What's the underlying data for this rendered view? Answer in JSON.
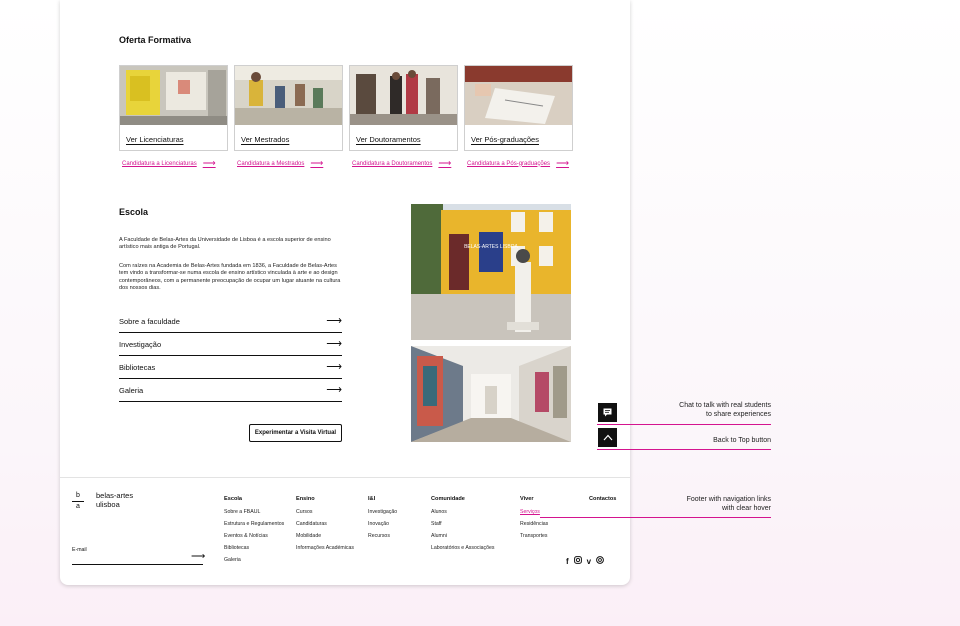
{
  "offer": {
    "title": "Oferta Formativa",
    "cards": [
      {
        "label": "Ver Licenciaturas",
        "apply": "Candidatura a Licenciaturas"
      },
      {
        "label": "Ver Mestrados",
        "apply": "Candidatura a Mestrados"
      },
      {
        "label": "Ver Doutoramentos",
        "apply": "Candidatura a Doutoramentos"
      },
      {
        "label": "Ver Pós-graduações",
        "apply": "Candidatura a Pós-graduações"
      }
    ]
  },
  "school": {
    "title": "Escola",
    "para1": "A Faculdade de Belas-Artes da Universidade de Lisboa é a escola superior de ensino artístico mais antiga de Portugal.",
    "para2": "Com raízes na Academia de Belas-Artes fundada em 1836, a Faculdade de Belas-Artes tem vindo a transformar-se numa escola de ensino artístico vinculada à arte e ao design contemporâneos, com a permanente preocupação de ocupar um lugar atuante na cultura dos nossos dias.",
    "links": [
      "Sobre a faculdade",
      "Investigação",
      "Bibliotecas",
      "Galeria"
    ],
    "virtual_button": "Experimentar a Visita Virtual",
    "banner_text": "BELAS-ARTES LISBOA"
  },
  "footer": {
    "logo_mark_top": "b",
    "logo_mark_bottom": "a",
    "logo_line1": "belas-artes",
    "logo_line2": "ulisboa",
    "email_label": "E-mail",
    "columns": [
      {
        "title": "Escola",
        "items": [
          "Sobre a FBAUL",
          "Estrutura e Regulamentos",
          "Eventos & Notícias",
          "Bibliotecas",
          "Galeria"
        ]
      },
      {
        "title": "Ensino",
        "items": [
          "Cursos",
          "Candidaturas",
          "Mobilidade",
          "Informações Académicas"
        ]
      },
      {
        "title": "I&I",
        "items": [
          "Investigação",
          "Inovação",
          "Recursos"
        ]
      },
      {
        "title": "Comunidade",
        "items": [
          "Alunos",
          "Staff",
          "Alumni",
          "Laboratórios e Associações"
        ]
      },
      {
        "title": "Viver",
        "items": [
          "Serviços",
          "Residências",
          "Transportes"
        ]
      },
      {
        "title": "Contactos",
        "items": []
      }
    ],
    "socials": [
      "facebook-icon",
      "instagram-icon",
      "vimeo-icon",
      "issuu-icon"
    ]
  },
  "annotations": {
    "chat": "Chat to talk with real students to share experiences",
    "chat_line1": "Chat to talk with real students",
    "chat_line2": "to share experiences",
    "top": "Back to Top button",
    "footer_line1": "Footer with navigation links",
    "footer_line2": "with clear hover"
  },
  "colors": {
    "accent": "#d4148f",
    "text": "#111111"
  }
}
